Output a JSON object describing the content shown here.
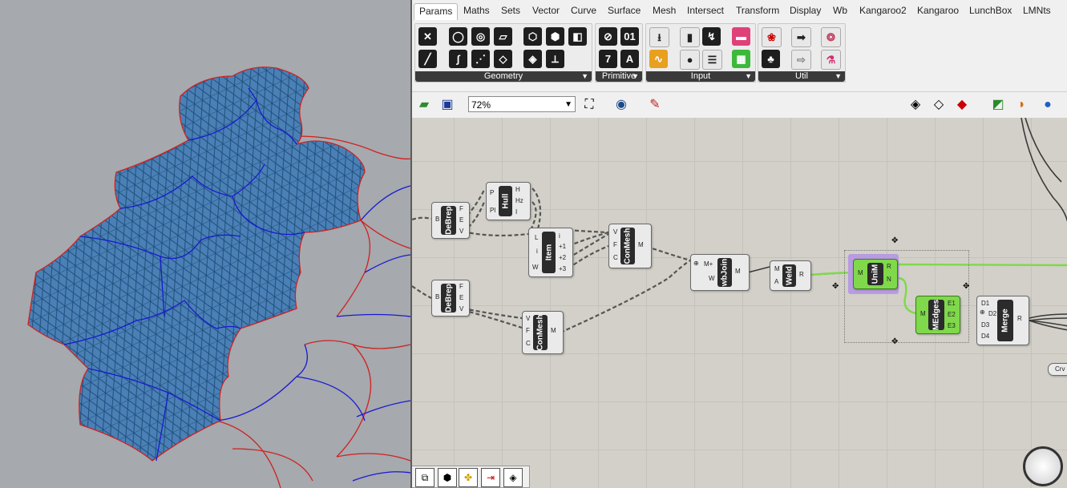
{
  "tabs": [
    "Params",
    "Maths",
    "Sets",
    "Vector",
    "Curve",
    "Surface",
    "Mesh",
    "Intersect",
    "Transform",
    "Display",
    "Wb",
    "Kangaroo2",
    "Kangaroo",
    "LunchBox",
    "LMNts"
  ],
  "ribbon_groups": [
    "Geometry",
    "Primitive",
    "Input",
    "Util"
  ],
  "zoom_value": "72%",
  "components": {
    "debrep1": {
      "title": "DeBrep",
      "in": [
        "B"
      ],
      "out": [
        "F",
        "E",
        "V"
      ]
    },
    "hull": {
      "title": "Hull",
      "in": [
        "P",
        "Pl"
      ],
      "out": [
        "H",
        "Hz",
        "I"
      ]
    },
    "item": {
      "title": "Item",
      "in": [
        "L",
        "i",
        "W"
      ],
      "out": [
        "i",
        "+1",
        "+2",
        "+3"
      ]
    },
    "conmesh1": {
      "title": "ConMesh",
      "in": [
        "V",
        "F",
        "C"
      ],
      "out": [
        "M"
      ]
    },
    "debrep2": {
      "title": "DeBrep",
      "in": [
        "B"
      ],
      "out": [
        "F",
        "E",
        "V"
      ]
    },
    "conmesh2": {
      "title": "ConMesh",
      "in": [
        "V",
        "F",
        "C"
      ],
      "out": [
        "M"
      ]
    },
    "wbjoin": {
      "title": "wbJoin",
      "in": [
        "M+",
        "W"
      ],
      "out": [
        "M"
      ]
    },
    "weld": {
      "title": "Weld",
      "in": [
        "M",
        "A"
      ],
      "out": [
        "R"
      ]
    },
    "unim": {
      "title": "UniM",
      "in": [
        "M"
      ],
      "out": [
        "R",
        "N"
      ]
    },
    "medges": {
      "title": "MEdges",
      "in": [
        "M"
      ],
      "out": [
        "E1",
        "E2",
        "E3"
      ]
    },
    "merge": {
      "title": "Merge",
      "in": [
        "D1",
        "D2",
        "D3",
        "D4"
      ],
      "out": [
        "R"
      ]
    }
  },
  "crv_label": "Crv",
  "primitive_numbers": [
    "7"
  ],
  "colors": {
    "mesh": "#4a7fb5",
    "mesh_edge": "#1c4f80",
    "red_edge": "#d02020",
    "blue_curve": "#1a1ad0",
    "wire_green": "#7fd94a"
  }
}
